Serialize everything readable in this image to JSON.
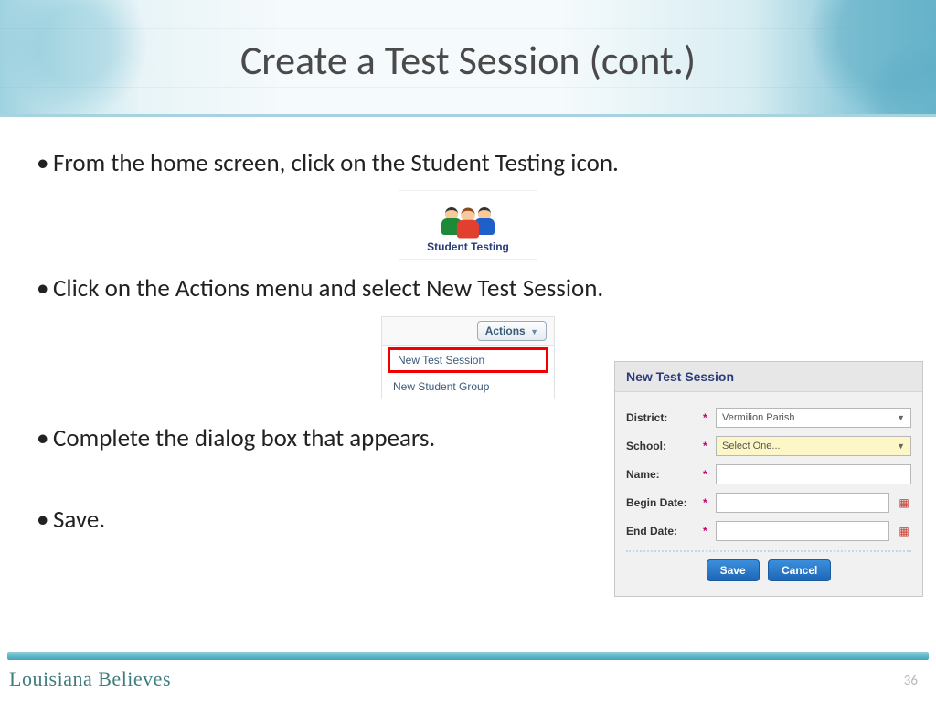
{
  "title": "Create a Test Session (cont.)",
  "bullets": {
    "b1": "From the home screen, click on the Student Testing icon.",
    "b2": "Click on the Actions menu and select New Test Session.",
    "b3": "Complete the dialog box that appears.",
    "b4": "Save."
  },
  "studentTesting": {
    "label": "Student Testing"
  },
  "actions": {
    "button": "Actions",
    "item1": "New Test Session",
    "item2": "New Student Group"
  },
  "dialog": {
    "title": "New Test Session",
    "labels": {
      "district": "District:",
      "school": "School:",
      "name": "Name:",
      "begin": "Begin Date:",
      "end": "End Date:"
    },
    "districtValue": "Vermilion Parish",
    "schoolPlaceholder": "Select One...",
    "save": "Save",
    "cancel": "Cancel",
    "required": "*"
  },
  "footer": {
    "brand": "Louisiana Believes",
    "page": "36"
  }
}
